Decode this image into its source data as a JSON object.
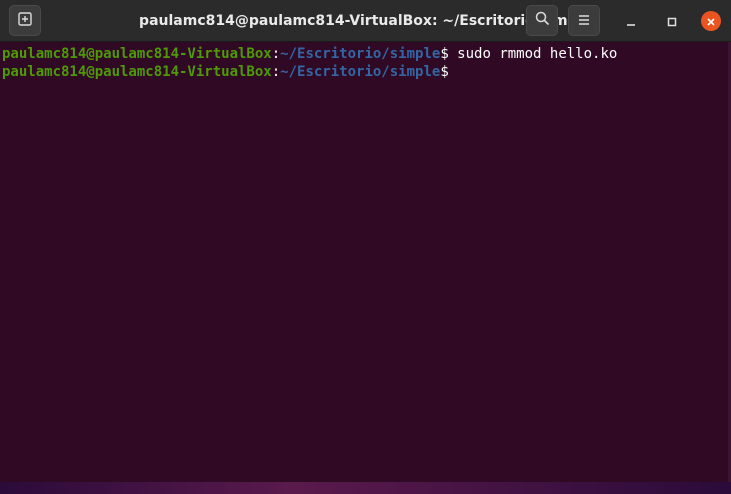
{
  "window": {
    "title": "paulamc814@paulamc814-VirtualBox: ~/Escritorio/simple"
  },
  "titlebar_icons": {
    "new_tab": "new-tab-icon",
    "search": "search-icon",
    "menu": "hamburger-menu-icon",
    "minimize": "minimize-icon",
    "maximize": "maximize-icon",
    "close": "close-icon"
  },
  "colors": {
    "terminal_bg": "#300a24",
    "prompt_user": "#4e9a06",
    "prompt_path": "#3465a4",
    "close_button": "#e95420"
  },
  "terminal": {
    "lines": [
      {
        "user": "paulamc814@paulamc814-VirtualBox",
        "sep": ":",
        "path": "~/Escritorio/simple",
        "dollar": "$",
        "command": " sudo rmmod hello.ko"
      },
      {
        "user": "paulamc814@paulamc814-VirtualBox",
        "sep": ":",
        "path": "~/Escritorio/simple",
        "dollar": "$",
        "command": ""
      }
    ]
  }
}
